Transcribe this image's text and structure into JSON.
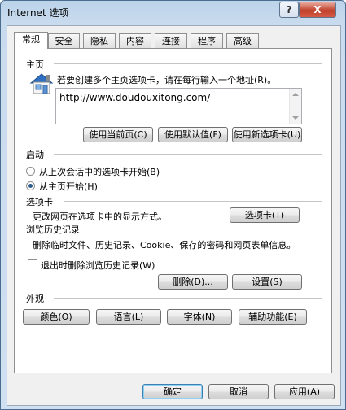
{
  "window": {
    "title": "Internet 选项",
    "help_label": "?",
    "close_label": "X"
  },
  "tabs": [
    {
      "label": "常规"
    },
    {
      "label": "安全"
    },
    {
      "label": "隐私"
    },
    {
      "label": "内容"
    },
    {
      "label": "连接"
    },
    {
      "label": "程序"
    },
    {
      "label": "高级"
    }
  ],
  "home": {
    "section_label": "主页",
    "description": "若要创建多个主页选项卡，请在每行输入一个地址(R)。",
    "url_value": "http://www.doudouxitong.com/",
    "buttons": {
      "use_current": "使用当前页(C)",
      "use_default": "使用默认值(F)",
      "use_new_tab": "使用新选项卡(U)"
    },
    "icon": "house-icon"
  },
  "startup": {
    "section_label": "启动",
    "option_last_session": "从上次会话中的选项卡开始(B)",
    "option_homepage": "从主页开始(H)",
    "selected": "homepage"
  },
  "tabs_section": {
    "section_label": "选项卡",
    "description": "更改网页在选项卡中的显示方式。",
    "button": "选项卡(T)"
  },
  "history": {
    "section_label": "浏览历史记录",
    "description": "删除临时文件、历史记录、Cookie、保存的密码和网页表单信息。",
    "checkbox_label": "退出时删除浏览历史记录(W)",
    "checked": false,
    "delete_button": "删除(D)...",
    "settings_button": "设置(S)"
  },
  "appearance": {
    "section_label": "外观",
    "colors_button": "颜色(O)",
    "languages_button": "语言(L)",
    "fonts_button": "字体(N)",
    "accessibility_button": "辅助功能(E)"
  },
  "footer": {
    "ok": "确定",
    "cancel": "取消",
    "apply": "应用(A)"
  }
}
